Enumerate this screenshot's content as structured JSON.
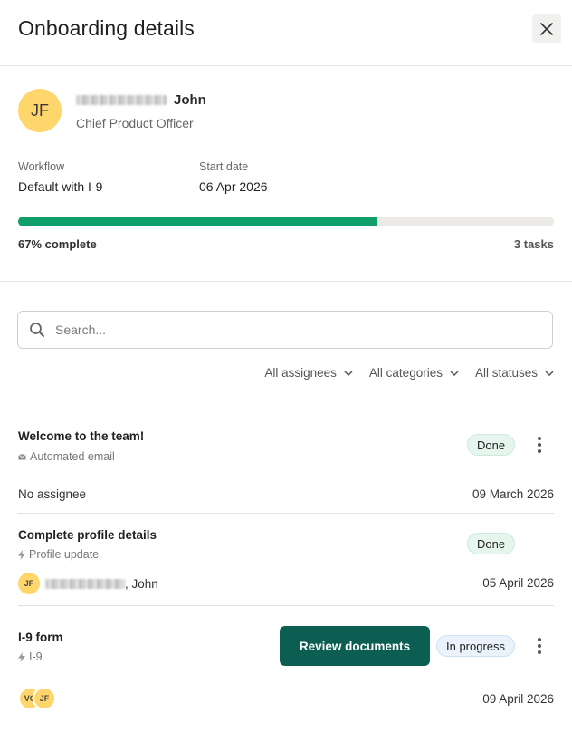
{
  "header": {
    "title": "Onboarding details",
    "close_icon": "close-icon"
  },
  "employee": {
    "initials": "JF",
    "name": "John",
    "role": "Chief Product Officer",
    "avatar_color": "#ffd66b"
  },
  "workflow": {
    "label": "Workflow",
    "value": "Default with I-9"
  },
  "start_date": {
    "label": "Start date",
    "value": "06 Apr 2026"
  },
  "progress": {
    "percent": 67,
    "label": "67% complete",
    "tasks": "3 tasks",
    "fill_color": "#0f9d6a"
  },
  "search": {
    "placeholder": "Search...",
    "icon": "search-icon"
  },
  "filters": [
    {
      "label": "All assignees"
    },
    {
      "label": "All categories"
    },
    {
      "label": "All statuses"
    }
  ],
  "tasks": [
    {
      "title": "Welcome to the team!",
      "type": "Automated email",
      "type_icon": "email-icon",
      "status": "Done",
      "assignee": "No assignee",
      "date": "09 March 2026"
    },
    {
      "title": "Complete profile details",
      "type": "Profile update",
      "type_icon": "lightning-icon",
      "status": "Done",
      "assignee_initials": "JF",
      "assignee": ", John",
      "date": "05 April 2026"
    },
    {
      "title": "I-9 form",
      "type": "I-9",
      "type_icon": "lightning-icon",
      "status": "In progress",
      "action": "Review documents",
      "assignee_initials": [
        "VC",
        "JF"
      ],
      "date": "09 April 2026"
    }
  ],
  "colors": {
    "primary_button": "#0c5e52",
    "done_badge": "#e6f6ee",
    "progress_badge": "#eaf3fb"
  }
}
